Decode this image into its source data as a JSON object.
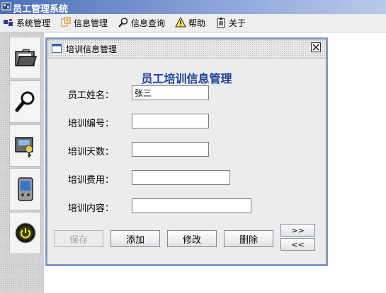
{
  "window": {
    "title": "员工管理系统"
  },
  "menu": [
    {
      "label": "系统管理",
      "icon": "system-icon"
    },
    {
      "label": "信息管理",
      "icon": "info-icon"
    },
    {
      "label": "信息查询",
      "icon": "search-icon"
    },
    {
      "label": "帮助",
      "icon": "warning-icon"
    },
    {
      "label": "关于",
      "icon": "about-icon"
    }
  ],
  "toolbar": [
    {
      "icon": "folder-icon"
    },
    {
      "icon": "magnifier-icon"
    },
    {
      "icon": "folder-key-icon"
    },
    {
      "icon": "pda-icon"
    },
    {
      "icon": "power-icon"
    }
  ],
  "dialog": {
    "title": "培训信息管理",
    "heading": "员工培训信息管理",
    "fields": [
      {
        "label": "员工姓名：",
        "value": "张三"
      },
      {
        "label": "培训编号：",
        "value": ""
      },
      {
        "label": "培训天数：",
        "value": ""
      },
      {
        "label": "培训费用：",
        "value": ""
      },
      {
        "label": "培训内容：",
        "value": ""
      }
    ],
    "buttons": {
      "save": "保存",
      "add": "添加",
      "modify": "修改",
      "delete": "删除",
      "next": ">>",
      "prev": "<<"
    }
  },
  "colors": {
    "title_bar": "#4c6fb8",
    "frame_border": "#7f9cc7",
    "heading": "#1c3f9c"
  }
}
